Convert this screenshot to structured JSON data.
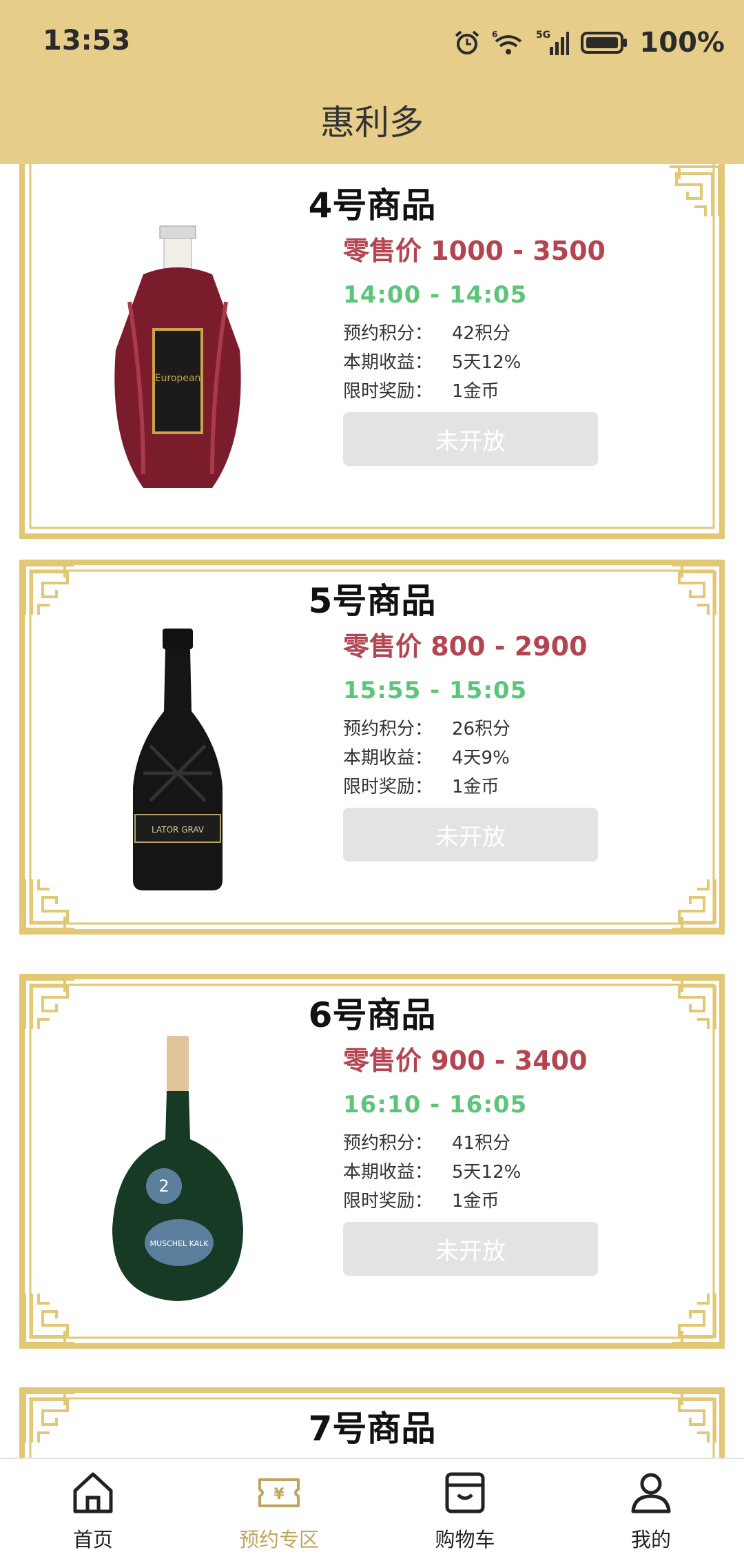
{
  "status": {
    "time": "13:53",
    "battery": "100%",
    "signal": "5G",
    "wifi_badge": "6"
  },
  "app": {
    "title": "惠利多"
  },
  "products": [
    {
      "name": "4号商品",
      "price": "零售价 1000 - 3500",
      "time": "14:00 - 14:05",
      "points_label": "预约积分：",
      "points": "42积分",
      "income_label": "本期收益：",
      "income": "5天12%",
      "reward_label": "限时奖励：",
      "reward": "1金币",
      "button": "未开放",
      "bottle": "cognac-bottle"
    },
    {
      "name": "5号商品",
      "price": "零售价 800 - 2900",
      "time": "15:55 - 15:05",
      "points_label": "预约积分：",
      "points": "26积分",
      "income_label": "本期收益：",
      "income": "4天9%",
      "reward_label": "限时奖励：",
      "reward": "1金币",
      "button": "未开放",
      "bottle": "dark-wine-bottle"
    },
    {
      "name": "6号商品",
      "price": "零售价 900 - 3400",
      "time": "16:10 - 16:05",
      "points_label": "预约积分：",
      "points": "41积分",
      "income_label": "本期收益：",
      "income": "5天12%",
      "reward_label": "限时奖励：",
      "reward": "1金币",
      "button": "未开放",
      "bottle": "green-bocksbeutel-bottle"
    },
    {
      "name": "7号商品"
    }
  ],
  "nav": [
    {
      "label": "首页",
      "icon": "home-icon"
    },
    {
      "label": "预约专区",
      "icon": "ticket-icon",
      "active": true
    },
    {
      "label": "购物车",
      "icon": "store-icon"
    },
    {
      "label": "我的",
      "icon": "user-icon"
    }
  ],
  "colors": {
    "gold": "#e6cd8a",
    "frame": "#e2c775",
    "price": "#b4444f",
    "time": "#5cc57a",
    "active_nav": "#bfa45c"
  }
}
